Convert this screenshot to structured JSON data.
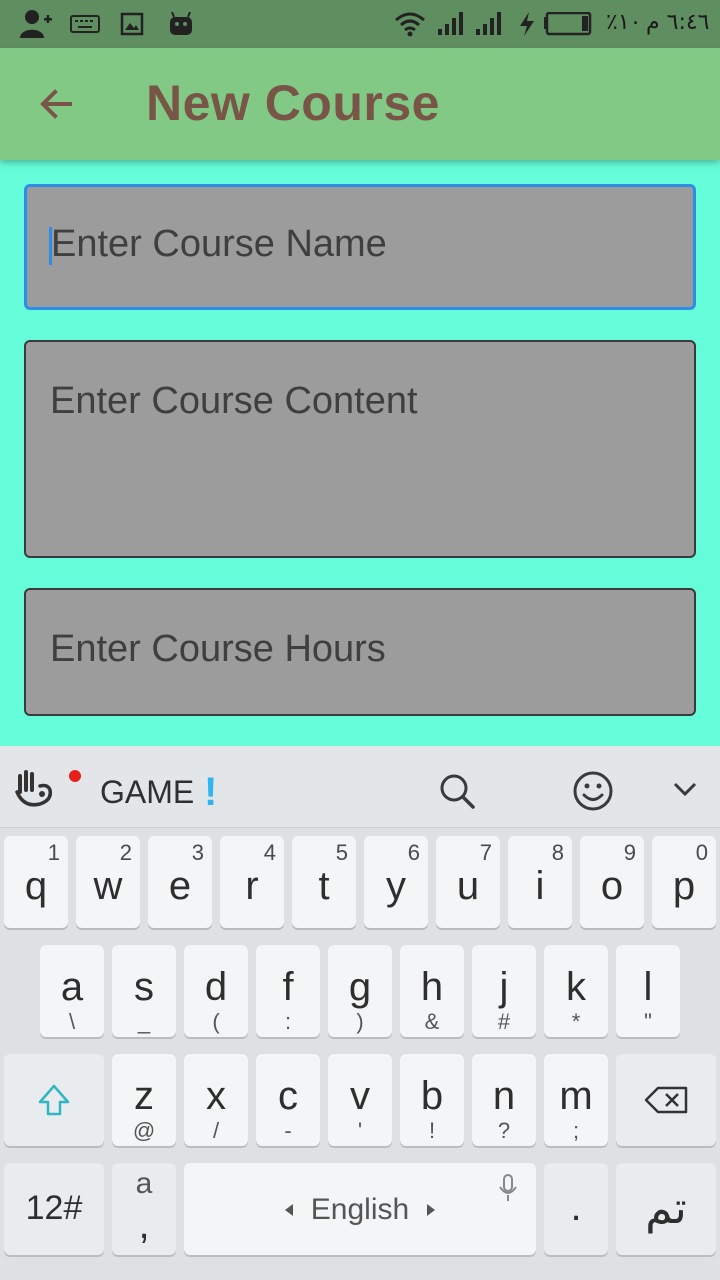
{
  "status_bar": {
    "time": "٦:٤٦ م",
    "battery_percent": "٪١٠",
    "icons": [
      "add-contact-icon",
      "keyboard-icon",
      "image-icon",
      "android-icon",
      "wifi-icon",
      "signal-icon",
      "signal-icon",
      "charging-icon",
      "battery-icon"
    ]
  },
  "app_bar": {
    "title": "New Course",
    "back_icon": "arrow-back-icon"
  },
  "form": {
    "course_name_placeholder": "Enter Course Name",
    "course_content_placeholder": "Enter Course Content",
    "course_hours_placeholder": "Enter Course Hours",
    "background_color": "#65fcd9",
    "field_color": "#9c9c9c",
    "focus_color": "#2d8ee8"
  },
  "keyboard": {
    "toolbar": {
      "game_label": "GAME",
      "exclaim": "!"
    },
    "row1": [
      {
        "k": "q",
        "h": "1"
      },
      {
        "k": "w",
        "h": "2"
      },
      {
        "k": "e",
        "h": "3"
      },
      {
        "k": "r",
        "h": "4"
      },
      {
        "k": "t",
        "h": "5"
      },
      {
        "k": "y",
        "h": "6"
      },
      {
        "k": "u",
        "h": "7"
      },
      {
        "k": "i",
        "h": "8"
      },
      {
        "k": "o",
        "h": "9"
      },
      {
        "k": "p",
        "h": "0"
      }
    ],
    "row2": [
      {
        "k": "a",
        "s": "\\"
      },
      {
        "k": "s",
        "s": "_"
      },
      {
        "k": "d",
        "s": "("
      },
      {
        "k": "f",
        "s": ":"
      },
      {
        "k": "g",
        "s": ")"
      },
      {
        "k": "h",
        "s": "&"
      },
      {
        "k": "j",
        "s": "#"
      },
      {
        "k": "k",
        "s": "*"
      },
      {
        "k": "l",
        "s": "\""
      }
    ],
    "row3": [
      {
        "k": "z",
        "s": "@"
      },
      {
        "k": "x",
        "s": "/"
      },
      {
        "k": "c",
        "s": "-"
      },
      {
        "k": "v",
        "s": "'"
      },
      {
        "k": "b",
        "s": "!"
      },
      {
        "k": "n",
        "s": "?"
      },
      {
        "k": "m",
        "s": ";"
      }
    ],
    "symbols_label": "12#",
    "comma_key_top": "a",
    "comma_key_bottom": ",",
    "space_label": "English",
    "period_label": ".",
    "done_label": "تم"
  }
}
